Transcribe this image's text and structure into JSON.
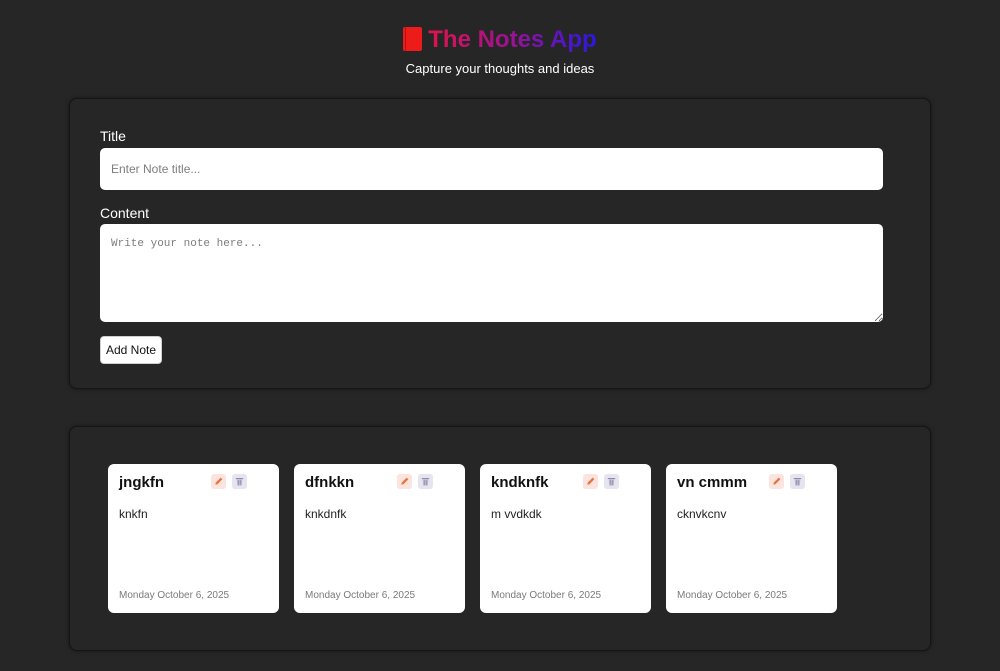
{
  "header": {
    "title": "The Notes App",
    "subtitle": "Capture your thoughts and ideas",
    "icon": "book-icon"
  },
  "form": {
    "title_label": "Title",
    "title_placeholder": "Enter Note title...",
    "title_value": "",
    "content_label": "Content",
    "content_placeholder": "Write your note here...",
    "content_value": "",
    "add_button_label": "Add Note"
  },
  "notes": [
    {
      "title": "jngkfn",
      "body": "knkfn",
      "date": "Monday October 6, 2025"
    },
    {
      "title": "dfnkkn",
      "body": "knkdnfk",
      "date": "Monday October 6, 2025"
    },
    {
      "title": "kndknfk",
      "body": "m vvdkdk",
      "date": "Monday October 6, 2025"
    },
    {
      "title": "vn cmmm",
      "body": "cknvkcnv",
      "date": "Monday October 6, 2025"
    }
  ],
  "colors": {
    "background": "#272627",
    "accent_red": "#ee1b1b",
    "gradient_start": "#e0144a",
    "gradient_mid": "#9a1296",
    "gradient_end": "#2a18e0",
    "edit_icon": "#e8743b",
    "delete_icon": "#8a8aa8"
  }
}
